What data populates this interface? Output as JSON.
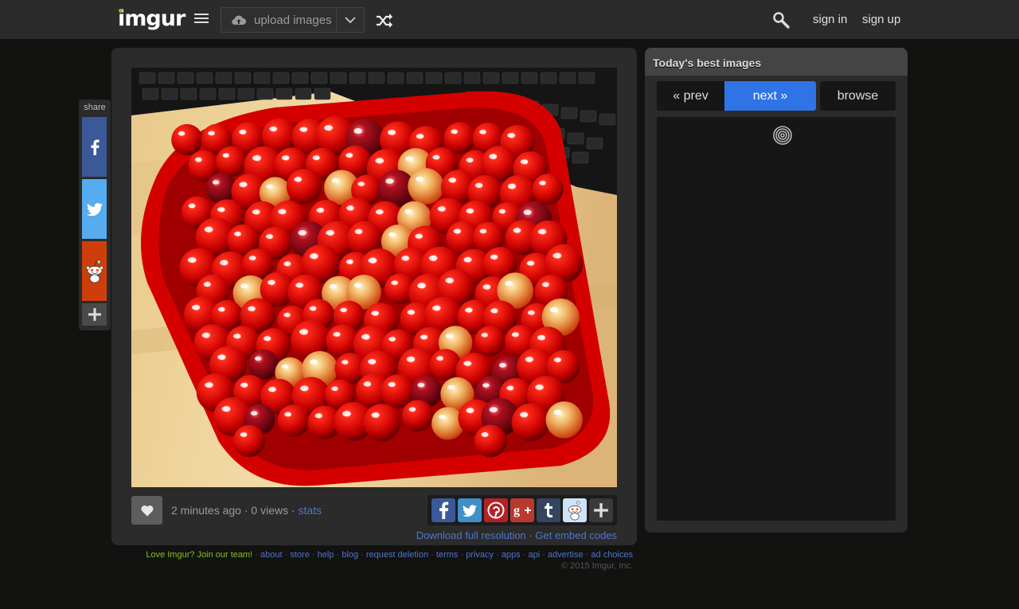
{
  "header": {
    "logo": "imgur",
    "upload_label": "upload images",
    "sign_in": "sign in",
    "sign_up": "sign up"
  },
  "share": {
    "label": "share"
  },
  "image": {
    "description": "",
    "time_ago": "2 minutes ago",
    "views": "0 views",
    "stats_link": "stats",
    "download_link": "Download full resolution",
    "embed_link": "Get embed codes"
  },
  "sidebar": {
    "title": "Today's best images",
    "prev": "« prev",
    "next": "next »",
    "browse": "browse"
  },
  "footer": {
    "join": "Love Imgur? Join our team!",
    "links": [
      "about",
      "store",
      "help",
      "blog",
      "request deletion",
      "terms",
      "privacy",
      "apps",
      "api",
      "advertise",
      "ad choices"
    ],
    "copyright": "© 2015 Imgur, Inc."
  },
  "colors": {
    "accent_green": "#85bf25",
    "link_blue": "#4e76c9",
    "next_button": "#2f74e6",
    "facebook": "#3b5998",
    "twitter": "#55acee",
    "reddit": "#ce3e0a"
  },
  "icons": [
    "menu-icon",
    "cloud-upload-icon",
    "chevron-down-icon",
    "shuffle-icon",
    "search-icon",
    "facebook-icon",
    "twitter-icon",
    "reddit-icon",
    "plus-icon",
    "heart-icon",
    "pinterest-icon",
    "google-plus-icon",
    "tumblr-icon",
    "spinner-icon"
  ]
}
